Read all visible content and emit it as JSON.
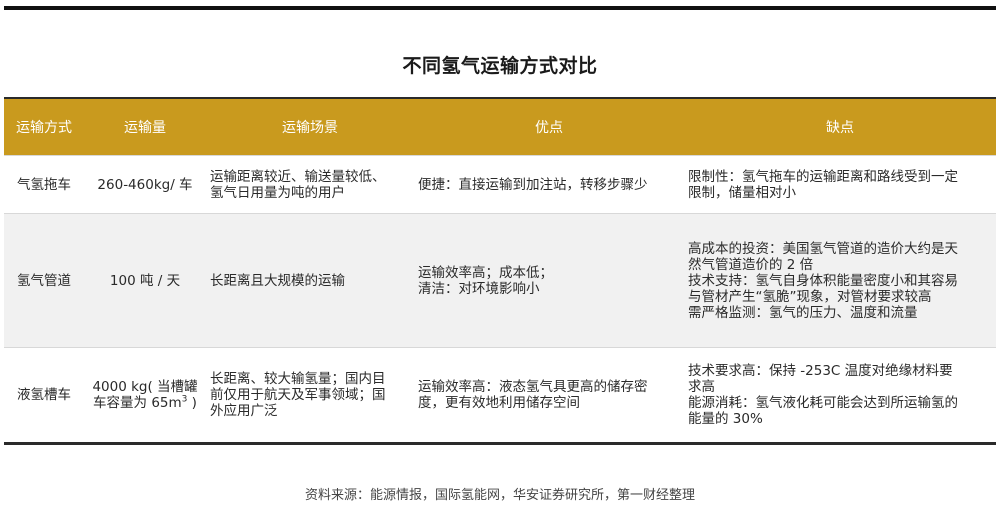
{
  "title": "不同氢气运输方式对比",
  "table": {
    "headers": [
      "运输方式",
      "运输量",
      "运输场景",
      "优点",
      "缺点"
    ],
    "rows": [
      {
        "method": "气氢拖车",
        "volume": [
          "260-460kg/ 车"
        ],
        "scene": [
          "运输距离较近、输送量较低、",
          "氢气日用量为吨的用户"
        ],
        "pros": [
          "便捷：直接运输到加注站，转移步骤少"
        ],
        "cons": [
          "限制性：氢气拖车的运输距离和路线受到一定",
          "限制，储量相对小"
        ]
      },
      {
        "method": "氢气管道",
        "volume": [
          "100 吨 / 天"
        ],
        "scene": [
          "长距离且大规模的运输"
        ],
        "pros": [
          "运输效率高；成本低；",
          "清洁：对环境影响小"
        ],
        "cons": [
          "高成本的投资：美国氢气管道的造价大约是天",
          "然气管道造价的 2 倍",
          "技术支持：氢气自身体积能量密度小和其容易",
          "与管材产生“氢脆”现象，对管材要求较高",
          "需严格监测：氢气的压力、温度和流量"
        ]
      },
      {
        "method": "液氢槽车",
        "volume": [
          "4000 kg( 当槽罐",
          "车容量为 65m",
          "3",
          " )"
        ],
        "scene": [
          "长距离、较大输氢量；国内目",
          "前仅用于航天及军事领域；国",
          "外应用广泛"
        ],
        "pros": [
          "运输效率高：液态氢气具更高的储存密",
          "度，更有效地利用储存空间"
        ],
        "cons": [
          "技术要求高：保持 -253C 温度对绝缘材料要",
          "求高",
          "能源消耗：氢气液化耗可能会达到所运输氢的",
          "能量的 30%"
        ]
      }
    ]
  },
  "source": "资料来源：能源情报，国际氢能网，华安证券研究所，第一财经整理",
  "colors": {
    "header_bg": "#c99a1e",
    "header_text": "#ffffff",
    "alt_row_bg": "#f1f1f1",
    "rule": "#111111"
  }
}
